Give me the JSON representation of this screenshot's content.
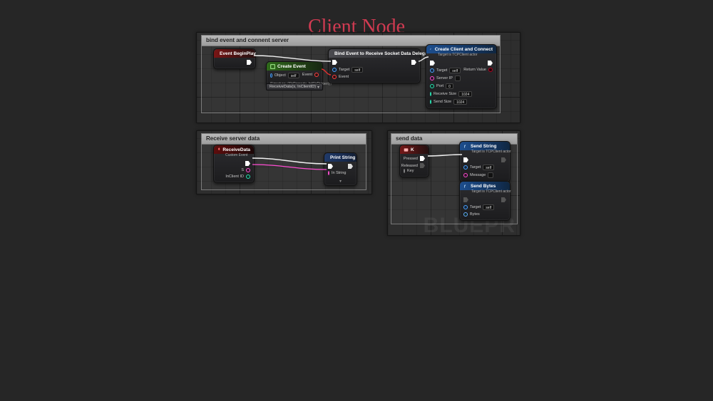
{
  "page": {
    "title": "Client Node"
  },
  "watermark": "BLUEPR",
  "comments": {
    "bind": {
      "title": "bind event and connent server"
    },
    "recv": {
      "title": "Receive server data"
    },
    "send": {
      "title": "send data"
    }
  },
  "nodes": {
    "begin_play": {
      "title": "Event BeginPlay"
    },
    "create_event": {
      "title": "Create Event",
      "in_object": "Object",
      "in_object_chip": "self",
      "out_event": "Event",
      "signature": "Signature: (StrProperty, IntStrProperty)",
      "dropdown": "ReceiveData(s, InClientID)"
    },
    "bind_event": {
      "title": "Bind Event to Receive Socket Data Delegate",
      "in_target": "Target",
      "in_target_chip": "self",
      "in_event": "Event"
    },
    "create_client": {
      "title": "Create Client and Connect",
      "subtitle": "Target is TCPClient actor",
      "in_target": "Target",
      "in_target_chip": "self",
      "in_serverip": "Server IP",
      "in_port": "Port",
      "in_port_chip": "0",
      "in_recv": "Receive Size",
      "in_recv_chip": "1024",
      "in_send": "Send Size",
      "in_send_chip": "1024",
      "out_return": "Return Value"
    },
    "receive_data": {
      "title": "ReceiveData",
      "subtitle": "Custom Event",
      "out_s": "S",
      "out_client": "InClient ID"
    },
    "print_string": {
      "title": "Print String",
      "in_string": "In String",
      "expand": "▾"
    },
    "key_k": {
      "title": "K",
      "out_pressed": "Pressed",
      "out_released": "Released",
      "in_key": "Key"
    },
    "send_string": {
      "title": "Send String",
      "subtitle": "Target is TCPClient actor",
      "in_target": "Target",
      "in_target_chip": "self",
      "in_message": "Message"
    },
    "send_bytes": {
      "title": "Send Bytes",
      "subtitle": "Target is TCPClient actor",
      "in_target": "Target",
      "in_target_chip": "self",
      "in_bytes": "Bytes"
    }
  }
}
